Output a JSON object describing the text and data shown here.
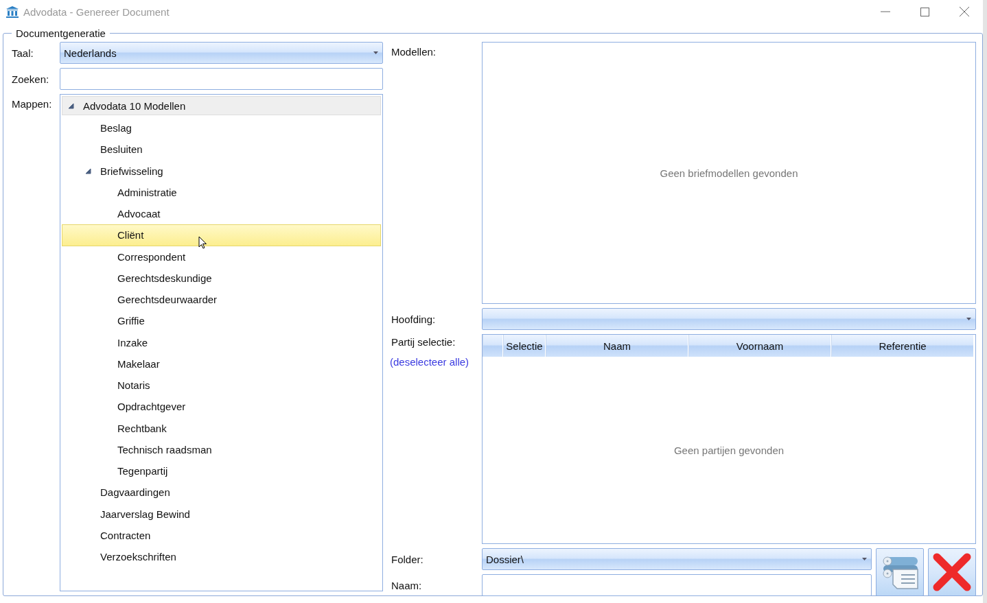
{
  "window": {
    "title": "Advodata - Genereer Document"
  },
  "group": {
    "title": "Documentgeneratie"
  },
  "language": {
    "label": "Taal:",
    "value": "Nederlands"
  },
  "search": {
    "label": "Zoeken:"
  },
  "folders": {
    "label": "Mappen:",
    "items": [
      {
        "label": "Advodata 10 Modellen",
        "expanded": true,
        "selected": false,
        "children": [
          {
            "label": "Beslag",
            "selected": false
          },
          {
            "label": "Besluiten",
            "selected": false
          },
          {
            "label": "Briefwisseling",
            "expanded": true,
            "selected": false,
            "children": [
              {
                "label": "Administratie",
                "selected": false
              },
              {
                "label": "Advocaat",
                "selected": false
              },
              {
                "label": "Cliënt",
                "selected": true
              },
              {
                "label": "Correspondent",
                "selected": false
              },
              {
                "label": "Gerechtsdeskundige",
                "selected": false
              },
              {
                "label": "Gerechtsdeurwaarder",
                "selected": false
              },
              {
                "label": "Griffie",
                "selected": false
              },
              {
                "label": "Inzake",
                "selected": false
              },
              {
                "label": "Makelaar",
                "selected": false
              },
              {
                "label": "Notaris",
                "selected": false
              },
              {
                "label": "Opdrachtgever",
                "selected": false
              },
              {
                "label": "Rechtbank",
                "selected": false
              },
              {
                "label": "Technisch raadsman",
                "selected": false
              },
              {
                "label": "Tegenpartij",
                "selected": false
              }
            ]
          },
          {
            "label": "Dagvaardingen",
            "selected": false
          },
          {
            "label": "Jaarverslag Bewind",
            "selected": false
          },
          {
            "label": "Contracten",
            "selected": false
          },
          {
            "label": "Verzoekschriften",
            "selected": false
          }
        ]
      }
    ]
  },
  "models": {
    "label": "Modellen:",
    "empty_text": "Geen briefmodellen gevonden"
  },
  "heading": {
    "label": "Hoofding:"
  },
  "parties": {
    "label": "Partij selectie:",
    "deselect_link": "(deselecteer alle)",
    "columns": [
      "Selectie",
      "Naam",
      "Voornaam",
      "Referentie"
    ],
    "empty_text": "Geen partijen gevonden"
  },
  "folder": {
    "label": "Folder:",
    "value": "Dossier\\"
  },
  "name": {
    "label": "Naam:"
  }
}
